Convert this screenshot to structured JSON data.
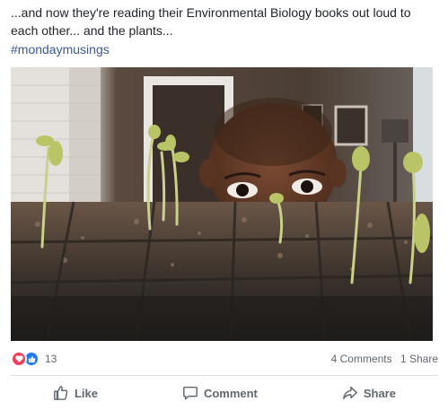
{
  "post": {
    "text": "...and now they're reading their Environmental Biology books out loud to each other... and the plants...",
    "hashtag": "#mondaymusings"
  },
  "photo": {
    "description_icon": "photo-image"
  },
  "reactions": {
    "icons": [
      "love-icon",
      "like-icon"
    ],
    "count": "13",
    "comments": "4 Comments",
    "shares": "1 Share"
  },
  "actions": {
    "like": "Like",
    "comment": "Comment",
    "share": "Share"
  },
  "colors": {
    "link": "#385898",
    "love": "#f33e58",
    "like": "#2078f4",
    "muted": "#606770"
  }
}
